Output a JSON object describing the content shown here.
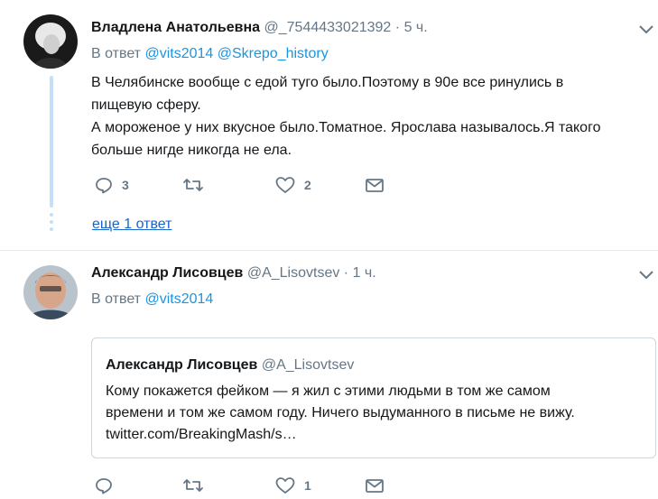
{
  "tweets": [
    {
      "name": "Владлена Анатольевна",
      "handle": "@_7544433021392",
      "separator": "·",
      "time": "5 ч.",
      "reply_label": "В ответ",
      "reply_to": [
        "@vits2014",
        "@Skrepo_history"
      ],
      "text_lines": [
        "В Челябинске вообще с едой туго было.Поэтому в 90е все ринулись в",
        "пищевую сферу.",
        "А мороженое у них вкусное было.Томатное. Ярослава называлось.Я такого",
        "больше нигде никогда не ела."
      ],
      "actions": {
        "replies": "3",
        "retweets": "",
        "likes": "2"
      },
      "more_replies": "еще 1 ответ"
    },
    {
      "name": "Александр Лисовцев",
      "handle": "@A_Lisovtsev",
      "separator": "·",
      "time": "1 ч.",
      "reply_label": "В ответ",
      "reply_to": [
        "@vits2014"
      ],
      "quote": {
        "name": "Александр Лисовцев",
        "handle": "@A_Lisovtsev",
        "text_lines": [
          "Кому покажется фейком — я жил с этими людьми в том же самом",
          "времени и том же самом году. Ничего выдуманного в письме не вижу.",
          "twitter.com/BreakingMash/s…"
        ]
      },
      "actions": {
        "replies": "",
        "retweets": "",
        "likes": "1"
      }
    }
  ],
  "icons": [
    "reply-icon",
    "retweet-icon",
    "like-icon",
    "message-icon",
    "chevron-down-icon"
  ],
  "colors": {
    "link": "#1b95e0",
    "muted": "#657786",
    "thread": "#c4dff6",
    "border": "#ccd6dd"
  }
}
